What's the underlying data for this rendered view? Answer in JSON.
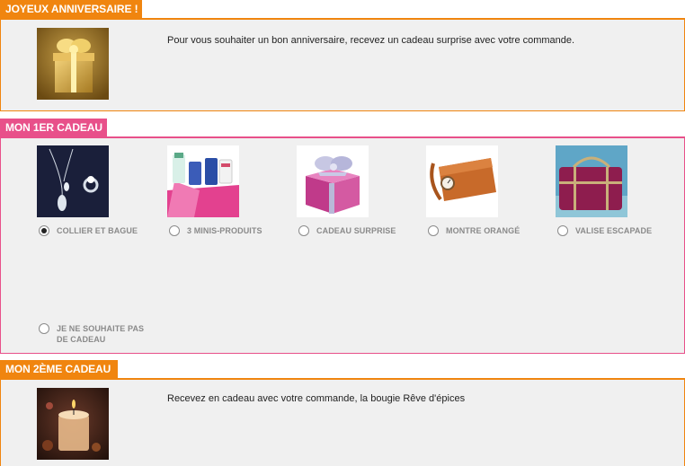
{
  "birthday": {
    "tab_label": "JOYEUX ANNIVERSAIRE !",
    "tab_color": "#f0850f",
    "image_icon": "gold-gift-box-image",
    "message": "Pour vous souhaiter un bon anniversaire, recevez un cadeau surprise avec votre commande."
  },
  "first_gift": {
    "tab_label": "MON 1ER CADEAU",
    "tab_color": "#e8508a",
    "options": [
      {
        "label": "COLLIER ET BAGUE",
        "image_icon": "necklace-ring-image",
        "selected": true
      },
      {
        "label": "3 MINIS-PRODUITS",
        "image_icon": "mini-products-image",
        "selected": false
      },
      {
        "label": "CADEAU SURPRISE",
        "image_icon": "pink-gift-box-image",
        "selected": false
      },
      {
        "label": "MONTRE ORANGÉ",
        "image_icon": "orange-watch-image",
        "selected": false
      },
      {
        "label": "VALISE ESCAPADE",
        "image_icon": "travel-bag-image",
        "selected": false
      }
    ],
    "no_gift_label": "JE NE SOUHAITE PAS DE CADEAU"
  },
  "second_gift": {
    "tab_label": "MON 2ÈME CADEAU",
    "tab_color": "#f0850f",
    "image_icon": "candle-image",
    "message": "Recevez en cadeau avec votre commande, la bougie Rêve d'épices"
  }
}
